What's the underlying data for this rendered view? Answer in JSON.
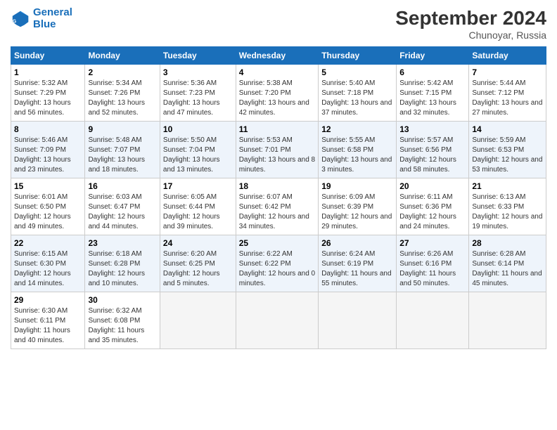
{
  "header": {
    "logo_line1": "General",
    "logo_line2": "Blue",
    "month": "September 2024",
    "location": "Chunoyar, Russia"
  },
  "days_of_week": [
    "Sunday",
    "Monday",
    "Tuesday",
    "Wednesday",
    "Thursday",
    "Friday",
    "Saturday"
  ],
  "weeks": [
    [
      {
        "num": "1",
        "sunrise": "Sunrise: 5:32 AM",
        "sunset": "Sunset: 7:29 PM",
        "daylight": "Daylight: 13 hours and 56 minutes."
      },
      {
        "num": "2",
        "sunrise": "Sunrise: 5:34 AM",
        "sunset": "Sunset: 7:26 PM",
        "daylight": "Daylight: 13 hours and 52 minutes."
      },
      {
        "num": "3",
        "sunrise": "Sunrise: 5:36 AM",
        "sunset": "Sunset: 7:23 PM",
        "daylight": "Daylight: 13 hours and 47 minutes."
      },
      {
        "num": "4",
        "sunrise": "Sunrise: 5:38 AM",
        "sunset": "Sunset: 7:20 PM",
        "daylight": "Daylight: 13 hours and 42 minutes."
      },
      {
        "num": "5",
        "sunrise": "Sunrise: 5:40 AM",
        "sunset": "Sunset: 7:18 PM",
        "daylight": "Daylight: 13 hours and 37 minutes."
      },
      {
        "num": "6",
        "sunrise": "Sunrise: 5:42 AM",
        "sunset": "Sunset: 7:15 PM",
        "daylight": "Daylight: 13 hours and 32 minutes."
      },
      {
        "num": "7",
        "sunrise": "Sunrise: 5:44 AM",
        "sunset": "Sunset: 7:12 PM",
        "daylight": "Daylight: 13 hours and 27 minutes."
      }
    ],
    [
      {
        "num": "8",
        "sunrise": "Sunrise: 5:46 AM",
        "sunset": "Sunset: 7:09 PM",
        "daylight": "Daylight: 13 hours and 23 minutes."
      },
      {
        "num": "9",
        "sunrise": "Sunrise: 5:48 AM",
        "sunset": "Sunset: 7:07 PM",
        "daylight": "Daylight: 13 hours and 18 minutes."
      },
      {
        "num": "10",
        "sunrise": "Sunrise: 5:50 AM",
        "sunset": "Sunset: 7:04 PM",
        "daylight": "Daylight: 13 hours and 13 minutes."
      },
      {
        "num": "11",
        "sunrise": "Sunrise: 5:53 AM",
        "sunset": "Sunset: 7:01 PM",
        "daylight": "Daylight: 13 hours and 8 minutes."
      },
      {
        "num": "12",
        "sunrise": "Sunrise: 5:55 AM",
        "sunset": "Sunset: 6:58 PM",
        "daylight": "Daylight: 13 hours and 3 minutes."
      },
      {
        "num": "13",
        "sunrise": "Sunrise: 5:57 AM",
        "sunset": "Sunset: 6:56 PM",
        "daylight": "Daylight: 12 hours and 58 minutes."
      },
      {
        "num": "14",
        "sunrise": "Sunrise: 5:59 AM",
        "sunset": "Sunset: 6:53 PM",
        "daylight": "Daylight: 12 hours and 53 minutes."
      }
    ],
    [
      {
        "num": "15",
        "sunrise": "Sunrise: 6:01 AM",
        "sunset": "Sunset: 6:50 PM",
        "daylight": "Daylight: 12 hours and 49 minutes."
      },
      {
        "num": "16",
        "sunrise": "Sunrise: 6:03 AM",
        "sunset": "Sunset: 6:47 PM",
        "daylight": "Daylight: 12 hours and 44 minutes."
      },
      {
        "num": "17",
        "sunrise": "Sunrise: 6:05 AM",
        "sunset": "Sunset: 6:44 PM",
        "daylight": "Daylight: 12 hours and 39 minutes."
      },
      {
        "num": "18",
        "sunrise": "Sunrise: 6:07 AM",
        "sunset": "Sunset: 6:42 PM",
        "daylight": "Daylight: 12 hours and 34 minutes."
      },
      {
        "num": "19",
        "sunrise": "Sunrise: 6:09 AM",
        "sunset": "Sunset: 6:39 PM",
        "daylight": "Daylight: 12 hours and 29 minutes."
      },
      {
        "num": "20",
        "sunrise": "Sunrise: 6:11 AM",
        "sunset": "Sunset: 6:36 PM",
        "daylight": "Daylight: 12 hours and 24 minutes."
      },
      {
        "num": "21",
        "sunrise": "Sunrise: 6:13 AM",
        "sunset": "Sunset: 6:33 PM",
        "daylight": "Daylight: 12 hours and 19 minutes."
      }
    ],
    [
      {
        "num": "22",
        "sunrise": "Sunrise: 6:15 AM",
        "sunset": "Sunset: 6:30 PM",
        "daylight": "Daylight: 12 hours and 14 minutes."
      },
      {
        "num": "23",
        "sunrise": "Sunrise: 6:18 AM",
        "sunset": "Sunset: 6:28 PM",
        "daylight": "Daylight: 12 hours and 10 minutes."
      },
      {
        "num": "24",
        "sunrise": "Sunrise: 6:20 AM",
        "sunset": "Sunset: 6:25 PM",
        "daylight": "Daylight: 12 hours and 5 minutes."
      },
      {
        "num": "25",
        "sunrise": "Sunrise: 6:22 AM",
        "sunset": "Sunset: 6:22 PM",
        "daylight": "Daylight: 12 hours and 0 minutes."
      },
      {
        "num": "26",
        "sunrise": "Sunrise: 6:24 AM",
        "sunset": "Sunset: 6:19 PM",
        "daylight": "Daylight: 11 hours and 55 minutes."
      },
      {
        "num": "27",
        "sunrise": "Sunrise: 6:26 AM",
        "sunset": "Sunset: 6:16 PM",
        "daylight": "Daylight: 11 hours and 50 minutes."
      },
      {
        "num": "28",
        "sunrise": "Sunrise: 6:28 AM",
        "sunset": "Sunset: 6:14 PM",
        "daylight": "Daylight: 11 hours and 45 minutes."
      }
    ],
    [
      {
        "num": "29",
        "sunrise": "Sunrise: 6:30 AM",
        "sunset": "Sunset: 6:11 PM",
        "daylight": "Daylight: 11 hours and 40 minutes."
      },
      {
        "num": "30",
        "sunrise": "Sunrise: 6:32 AM",
        "sunset": "Sunset: 6:08 PM",
        "daylight": "Daylight: 11 hours and 35 minutes."
      },
      null,
      null,
      null,
      null,
      null
    ]
  ]
}
